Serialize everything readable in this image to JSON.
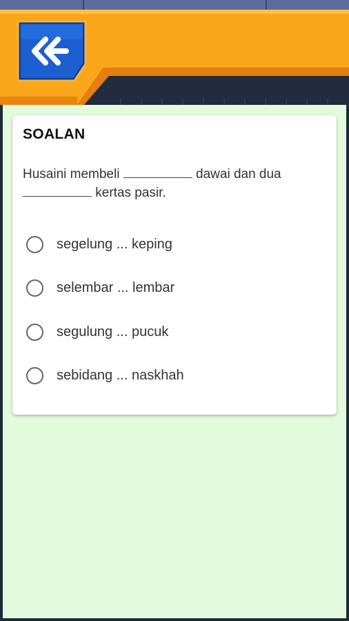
{
  "header": {
    "back_button_label": "Back",
    "icon": "double-chevron-left-icon"
  },
  "card": {
    "title": "SOALAN",
    "question": {
      "part1": "Husaini membeli",
      "part2": "dawai dan dua",
      "part3": "kertas pasir."
    },
    "options": [
      {
        "label": "segelung ... keping"
      },
      {
        "label": "selembar ... lembar"
      },
      {
        "label": "segulung ... pucuk"
      },
      {
        "label": "sebidang ... naskhah"
      }
    ]
  },
  "colors": {
    "header_orange": "#f9a61a",
    "header_dark_orange": "#e57f10",
    "button_blue": "#1c5fd0",
    "content_green": "#e2fbdc"
  }
}
